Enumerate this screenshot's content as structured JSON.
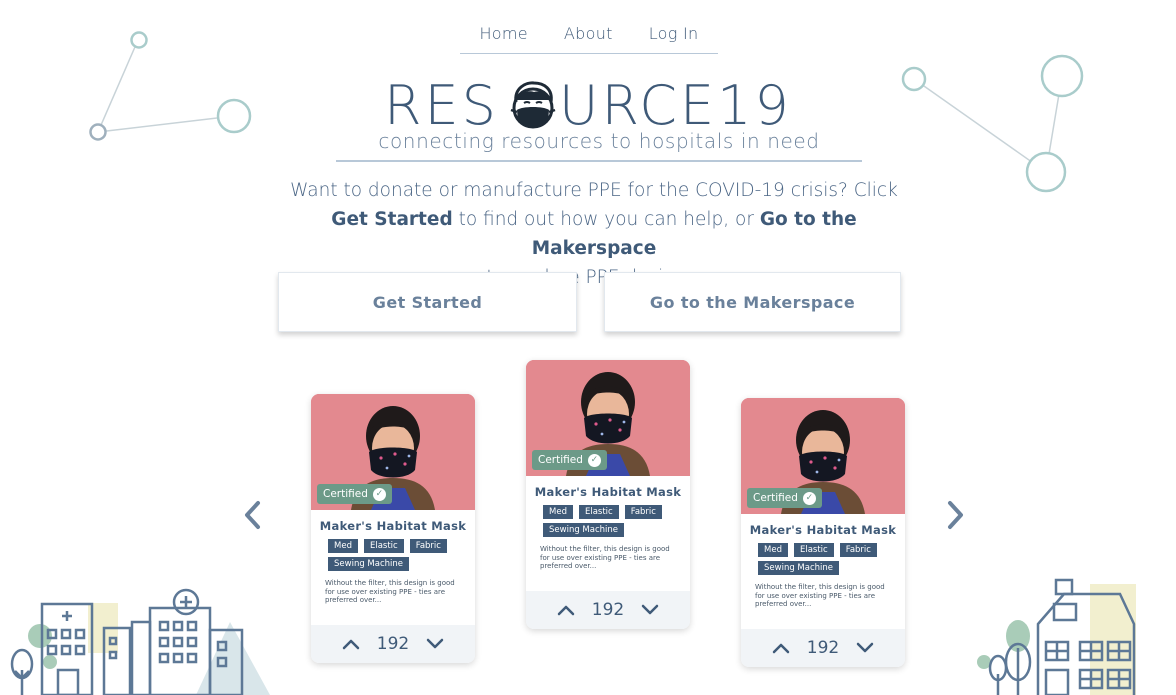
{
  "nav": {
    "home": "Home",
    "about": "About",
    "login": "Log In"
  },
  "logo": {
    "text_left": "RES",
    "text_right": "URCE19",
    "tagline": "connecting resources to hospitals in need"
  },
  "intro": {
    "part1": "Want to donate or manufacture PPE for the COVID-19 crisis? Click",
    "bold1": "Get Started",
    "part2": " to find out how you can help, or ",
    "bold2": "Go to the Makerspace",
    "part3": "to explore PPE designs."
  },
  "buttons": {
    "get_started": "Get Started",
    "makerspace": "Go to the Makerspace"
  },
  "cards": [
    {
      "badge": "Certified",
      "title": "Maker's Habitat Mask",
      "tags": [
        "Med",
        "Elastic",
        "Fabric",
        "Sewing Machine"
      ],
      "description": "Without the filter, this design is good for use over existing PPE - ties are preferred over...",
      "votes": "192"
    },
    {
      "badge": "Certified",
      "title": "Maker's Habitat Mask",
      "tags": [
        "Med",
        "Elastic",
        "Fabric",
        "Sewing Machine"
      ],
      "description": "Without the filter, this design is good for use over existing PPE - ties are preferred over...",
      "votes": "192"
    },
    {
      "badge": "Certified",
      "title": "Maker's Habitat Mask",
      "tags": [
        "Med",
        "Elastic",
        "Fabric",
        "Sewing Machine"
      ],
      "description": "Without the filter, this design is good for use over existing PPE - ties are preferred over...",
      "votes": "192"
    }
  ],
  "colors": {
    "brand": "#3f5a78",
    "certified": "#6c9a88",
    "photo_bg": "#e3898f",
    "deco_teal": "#a9cccb"
  }
}
